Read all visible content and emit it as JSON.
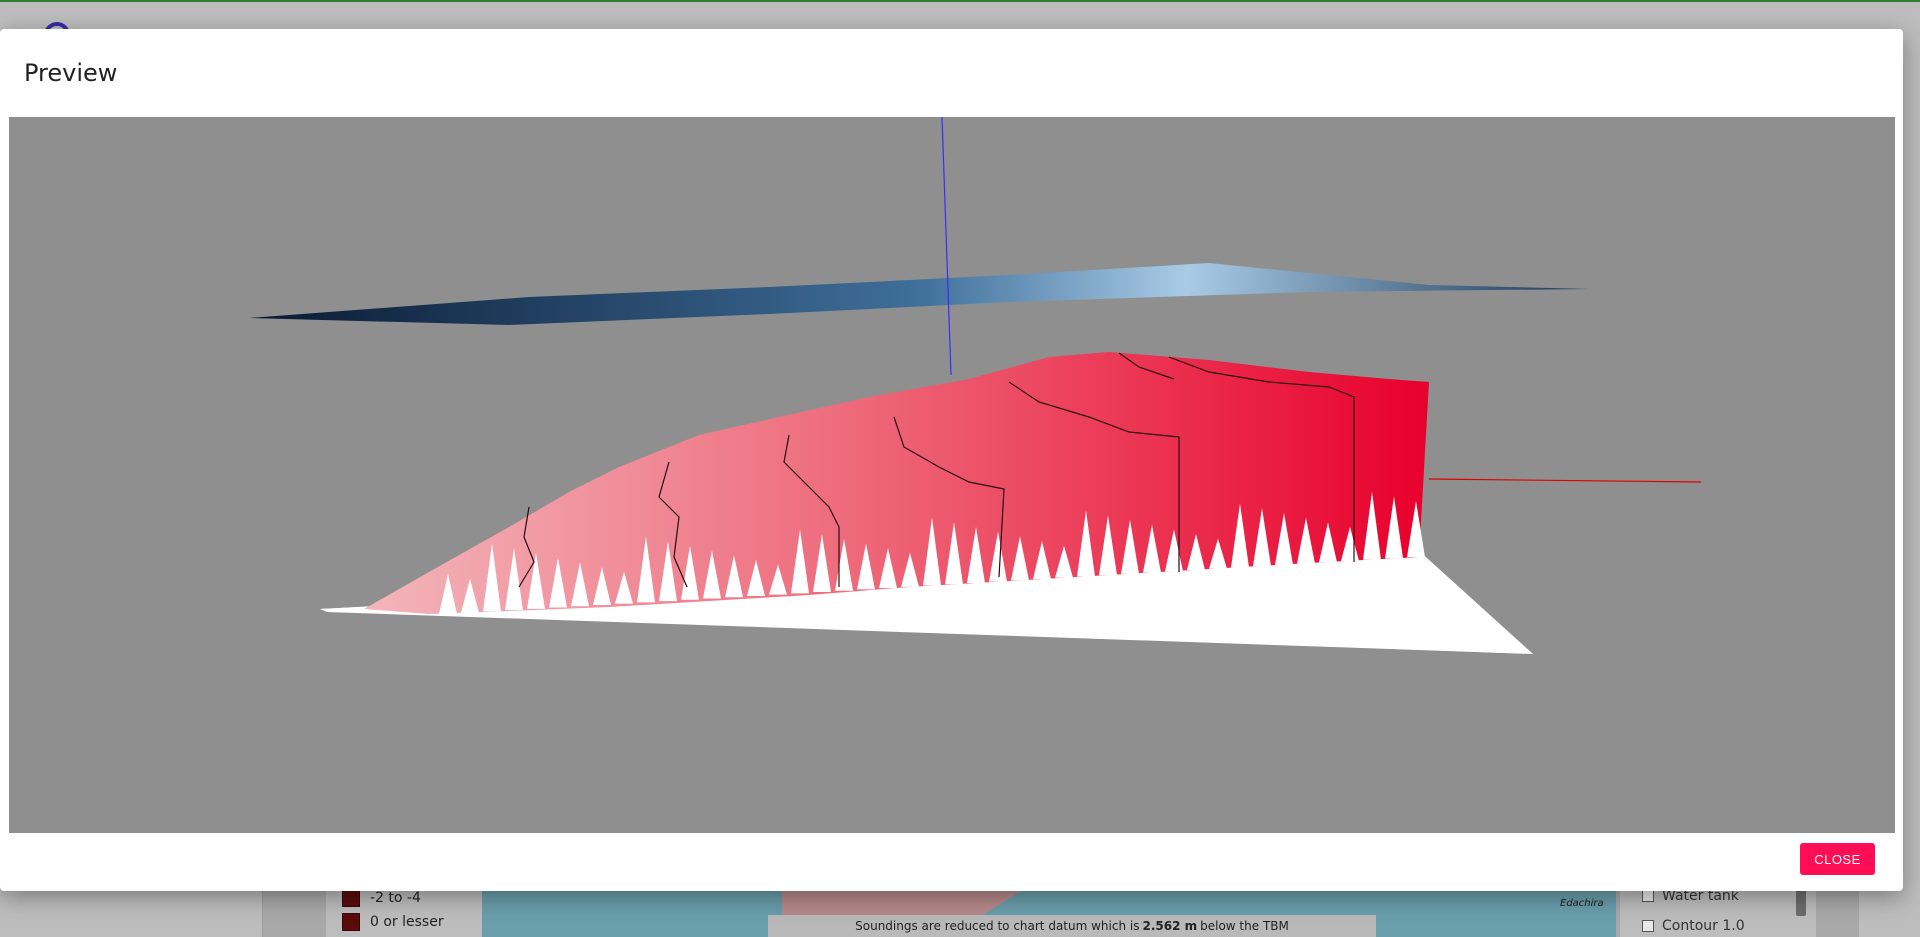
{
  "modal": {
    "title": "Preview",
    "close_label": "CLOSE"
  },
  "background": {
    "legend": [
      {
        "label": "-2 to -4"
      },
      {
        "label": "0 or lesser"
      }
    ],
    "layers": [
      {
        "label": "Water tank"
      },
      {
        "label": "Contour 1.0"
      }
    ],
    "note": {
      "prefix": "Soundings are reduced to chart datum which is",
      "value": "2.562 m",
      "suffix": "below the TBM"
    },
    "map_place": "Edachira"
  },
  "colors": {
    "accent": "#ff0d55",
    "viewer_bg": "#8f8f8f",
    "surface_light": "#f2b0b6",
    "surface_dark": "#e8002c",
    "water": "#0b1f3a",
    "axis_y": "#3b2cff",
    "axis_x": "#e00000"
  }
}
